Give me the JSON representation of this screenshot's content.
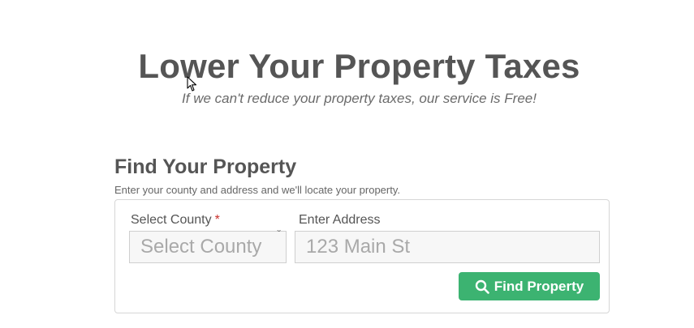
{
  "hero": {
    "title": "Lower Your Property Taxes",
    "subtitle": "If we can't reduce your property taxes, our service is Free!"
  },
  "find_section": {
    "title": "Find Your Property",
    "description": "Enter your county and address and we'll locate your property.",
    "county_label": "Select County",
    "required_mark": "*",
    "county_select_value": "Select County",
    "address_label": "Enter Address",
    "address_placeholder": "123 Main St",
    "address_value": "",
    "button_label": "Find Property",
    "button_icon": "search-icon"
  },
  "colors": {
    "accent": "#3cb371",
    "text": "#555555",
    "required": "#c9302c"
  }
}
